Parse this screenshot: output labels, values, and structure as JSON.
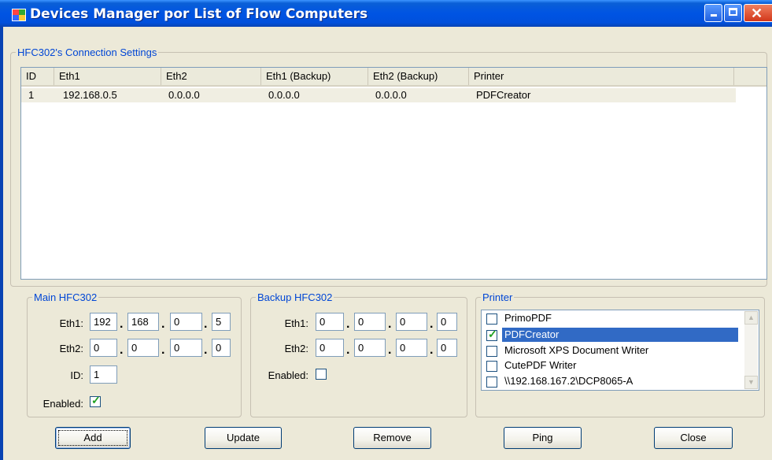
{
  "window": {
    "title": "Devices Manager por List of Flow Computers"
  },
  "connection_group": {
    "legend": "HFC302's Connection Settings",
    "columns": [
      "ID",
      "Eth1",
      "Eth2",
      "Eth1 (Backup)",
      "Eth2 (Backup)",
      "Printer"
    ],
    "rows": [
      [
        "1",
        "192.168.0.5",
        "0.0.0.0",
        "0.0.0.0",
        "0.0.0.0",
        "PDFCreator"
      ]
    ]
  },
  "main_group": {
    "legend": "Main HFC302",
    "eth1_label": "Eth1:",
    "eth1": [
      "192",
      "168",
      "0",
      "5"
    ],
    "eth2_label": "Eth2:",
    "eth2": [
      "0",
      "0",
      "0",
      "0"
    ],
    "id_label": "ID:",
    "id_value": "1",
    "enabled_label": "Enabled:",
    "enabled": true
  },
  "backup_group": {
    "legend": "Backup HFC302",
    "eth1_label": "Eth1:",
    "eth1": [
      "0",
      "0",
      "0",
      "0"
    ],
    "eth2_label": "Eth2:",
    "eth2": [
      "0",
      "0",
      "0",
      "0"
    ],
    "enabled_label": "Enabled:",
    "enabled": false
  },
  "printer_group": {
    "legend": "Printer",
    "items": [
      {
        "label": "PrimoPDF",
        "checked": false,
        "selected": false
      },
      {
        "label": "PDFCreator",
        "checked": true,
        "selected": true
      },
      {
        "label": "Microsoft XPS Document Writer",
        "checked": false,
        "selected": false
      },
      {
        "label": "CutePDF Writer",
        "checked": false,
        "selected": false
      },
      {
        "label": "\\\\192.168.167.2\\DCP8065-A",
        "checked": false,
        "selected": false
      }
    ]
  },
  "buttons": {
    "add": "Add",
    "update": "Update",
    "remove": "Remove",
    "ping": "Ping",
    "close": "Close"
  },
  "icons": {
    "app": "app-grid-icon",
    "minimize": "minimize-icon",
    "maximize": "maximize-icon",
    "close": "close-icon",
    "check": "check-icon"
  },
  "colors": {
    "titlebar": "#0054e3",
    "accent_legend": "#0046d5",
    "selection": "#316ac5",
    "check": "#21a121"
  }
}
